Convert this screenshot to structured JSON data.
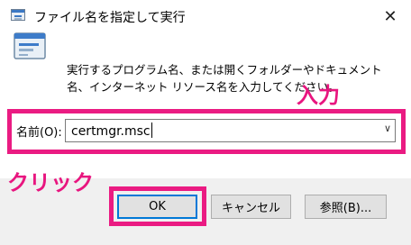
{
  "window": {
    "title": "ファイル名を指定して実行",
    "close_glyph": "✕"
  },
  "dialog": {
    "description": "実行するプログラム名、または開くフォルダーやドキュメント名、インターネット リソース名を入力してください。",
    "name_label": "名前(O):",
    "input_value": "certmgr.msc",
    "dropdown_glyph": "∨"
  },
  "buttons": {
    "ok": "OK",
    "cancel": "キャンセル",
    "browse": "参照(B)..."
  },
  "annotations": {
    "input_hint": "入力",
    "click_hint": "クリック"
  },
  "colors": {
    "highlight": "#ea1b82",
    "default_button_border": "#0078d7",
    "footer_bg": "#f0f0f0"
  }
}
